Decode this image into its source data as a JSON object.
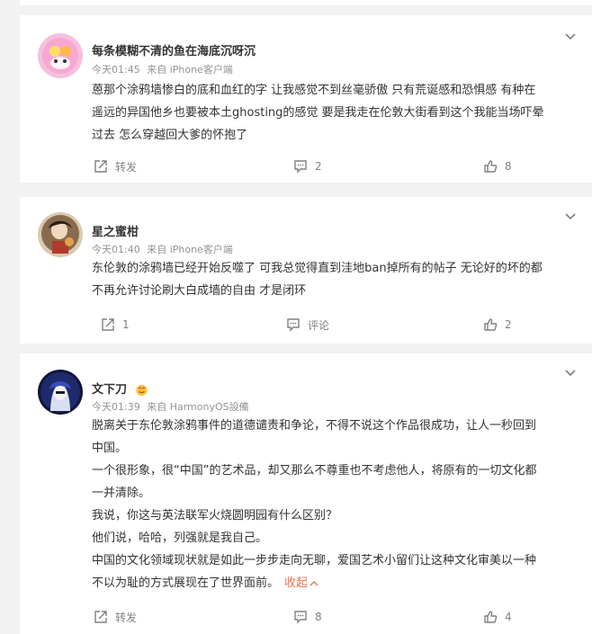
{
  "comments": [
    {
      "username": "每条模糊不清的鱼在海底沉呀沉",
      "time": "今天01:45",
      "source": "来自 iPhone客户端",
      "lines": [
        "蒽那个涂鸦墙惨白的底和血红的字 让我感觉不到丝毫骄傲 只有荒诞感和恐惧感 有种在",
        "遥远的异国他乡也要被本土ghosting的感觉 要是我走在伦敦大街看到这个我能当场吓晕",
        "过去 怎么穿越回大爹的怀抱了"
      ],
      "actions": {
        "repost": "转发",
        "comment": "2",
        "like": "8"
      }
    },
    {
      "username": "星之蜜柑",
      "time": "今天01:40",
      "source": "来自 iPhone客户端",
      "lines": [
        "东伦敦的涂鸦墙已经开始反噬了 可我总觉得直到洼地ban掉所有的帖子 无论好的坏的都",
        "不再允许讨论刷大白成墙的自由 才是闭环"
      ],
      "actions": {
        "repost": "1",
        "comment": "评论",
        "like": "2"
      }
    },
    {
      "username": "文下刀",
      "time": "今天01:39",
      "source": "来自 HarmonyOS設備",
      "lines": [
        "脱离关于东伦敦涂鸦事件的道德谴责和争论，不得不说这个作品很成功，让人一秒回到",
        "中国。",
        "一个很形象，很“中国”的艺术品，却又那么不尊重也不考虑他人，将原有的一切文化都",
        "一并清除。",
        "我说，你这与英法联军火烧圆明园有什么区别？",
        "他们说，哈哈，列强就是我自己。",
        "中国的文化领域现状就是如此一步步走向无聊，爱国艺术小留们让这种文化审美以一种",
        "不以为耻的方式展现在了世界面前。"
      ],
      "collapse_label": "收起",
      "actions": {
        "repost": "转发",
        "comment": "8",
        "like": "4"
      }
    }
  ],
  "icons": {
    "repost": "repost-icon",
    "comment": "comment-icon",
    "like": "thumbs-up-icon",
    "more": "chevron-down-icon",
    "badge": "smile-emoji-icon"
  },
  "colors": {
    "background": "#f2f2f2",
    "card": "#ffffff",
    "text": "#333333",
    "meta": "#939393",
    "action": "#808080",
    "collapse": "#eb7350"
  }
}
